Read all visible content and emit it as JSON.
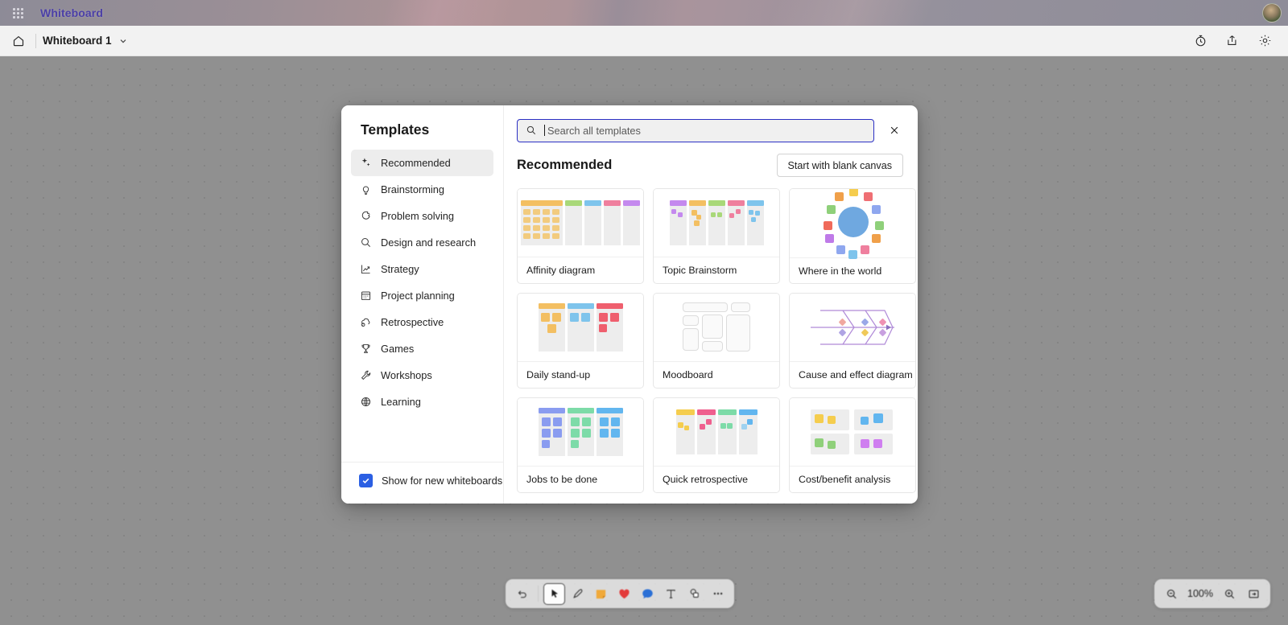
{
  "app": {
    "brand_title": "Whiteboard",
    "waffle_icon": "app-launcher-icon",
    "avatar_icon": "user-avatar"
  },
  "commandbar": {
    "home_icon": "home-icon",
    "doc_title": "Whiteboard 1",
    "chevron_icon": "chevron-down-icon",
    "timer_icon": "timer-icon",
    "share_icon": "share-icon",
    "settings_icon": "gear-icon"
  },
  "modal": {
    "title": "Templates",
    "close_icon": "close-icon",
    "search": {
      "placeholder": "Search all templates",
      "value": "",
      "icon": "search-icon"
    },
    "sidebar": {
      "items": [
        {
          "label": "Recommended",
          "icon": "sparkle-icon",
          "active": true
        },
        {
          "label": "Brainstorming",
          "icon": "lightbulb-icon",
          "active": false
        },
        {
          "label": "Problem solving",
          "icon": "puzzle-icon",
          "active": false
        },
        {
          "label": "Design and research",
          "icon": "magnifier-icon",
          "active": false
        },
        {
          "label": "Strategy",
          "icon": "trend-up-icon",
          "active": false
        },
        {
          "label": "Project planning",
          "icon": "calendar-icon",
          "active": false
        },
        {
          "label": "Retrospective",
          "icon": "cloud-arrow-icon",
          "active": false
        },
        {
          "label": "Games",
          "icon": "trophy-icon",
          "active": false
        },
        {
          "label": "Workshops",
          "icon": "wrench-icon",
          "active": false
        },
        {
          "label": "Learning",
          "icon": "globe-book-icon",
          "active": false
        }
      ],
      "footer_checkbox": {
        "label": "Show for new whiteboards",
        "checked": true,
        "color": "#2b5fe3"
      }
    },
    "section": {
      "heading": "Recommended",
      "blank_canvas_button": "Start with blank canvas"
    },
    "templates": [
      {
        "label": "Affinity diagram",
        "thumb": "affinity"
      },
      {
        "label": "Topic Brainstorm",
        "thumb": "topic-brainstorm"
      },
      {
        "label": "Where in the world",
        "thumb": "where-world"
      },
      {
        "label": "Daily stand-up",
        "thumb": "daily-standup"
      },
      {
        "label": "Moodboard",
        "thumb": "moodboard"
      },
      {
        "label": "Cause and effect diagram",
        "thumb": "fishbone"
      },
      {
        "label": "Jobs to be done",
        "thumb": "jobs-to-be-done"
      },
      {
        "label": "Quick retrospective",
        "thumb": "quick-retro"
      },
      {
        "label": "Cost/benefit analysis",
        "thumb": "cost-benefit"
      }
    ]
  },
  "toolbar": {
    "items": [
      {
        "icon": "undo-icon",
        "label": "Undo",
        "selected": false
      },
      {
        "icon": "cursor-icon",
        "label": "Select",
        "selected": true
      },
      {
        "icon": "pen-icon",
        "label": "Pen",
        "selected": false
      },
      {
        "icon": "note-icon",
        "label": "Sticky note",
        "selected": false
      },
      {
        "icon": "heart-icon",
        "label": "Reaction",
        "selected": false
      },
      {
        "icon": "comment-icon",
        "label": "Comment",
        "selected": false
      },
      {
        "icon": "text-icon",
        "label": "Text",
        "selected": false
      },
      {
        "icon": "shapes-icon",
        "label": "Shapes",
        "selected": false
      },
      {
        "icon": "more-icon",
        "label": "More",
        "selected": false
      }
    ]
  },
  "zoom_controls": {
    "zoom_out_icon": "zoom-out-icon",
    "level": "100%",
    "zoom_in_icon": "zoom-in-icon",
    "fit_icon": "fit-to-screen-icon"
  },
  "colors": {
    "accent_brand": "#4b3fa7",
    "search_focus": "#2b2fc4",
    "checkbox": "#2b5fe3",
    "canvas": "#909090"
  }
}
